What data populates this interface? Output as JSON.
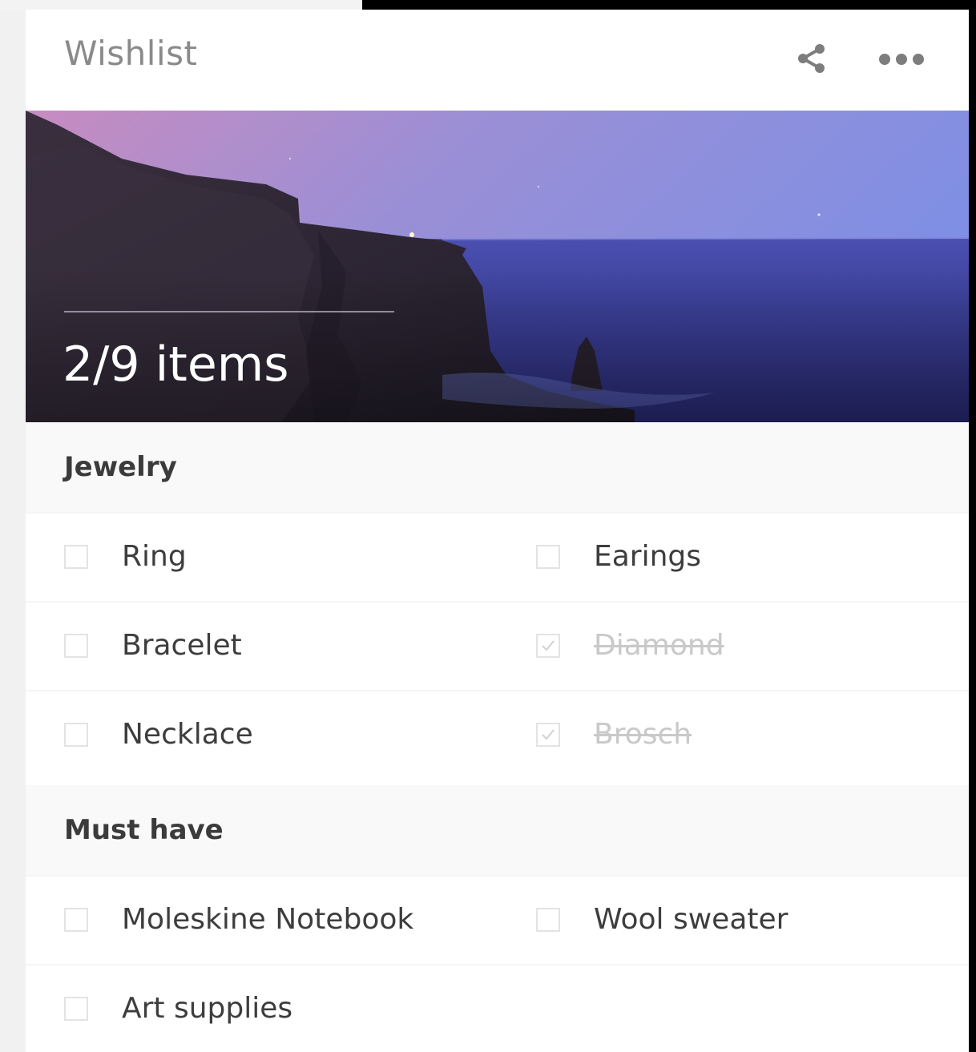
{
  "header": {
    "title": "Wishlist"
  },
  "hero": {
    "count_text": "2/9 items"
  },
  "sections": [
    {
      "title": "Jewelry",
      "items": [
        {
          "label": "Ring",
          "checked": false
        },
        {
          "label": "Earings",
          "checked": false
        },
        {
          "label": "Bracelet",
          "checked": false
        },
        {
          "label": "Diamond",
          "checked": true
        },
        {
          "label": "Necklace",
          "checked": false
        },
        {
          "label": "Brosch",
          "checked": true
        }
      ]
    },
    {
      "title": "Must have",
      "items": [
        {
          "label": "Moleskine Notebook",
          "checked": false
        },
        {
          "label": "Wool sweater",
          "checked": false
        },
        {
          "label": "Art supplies",
          "checked": false
        }
      ]
    }
  ],
  "icons": {
    "share": "share-icon",
    "more": "more-horizontal-icon"
  },
  "colors": {
    "title": "#8a8a8a",
    "text": "#3d3d3d",
    "done_text": "#c9c9c9",
    "section_bg": "#f9f9f9"
  }
}
